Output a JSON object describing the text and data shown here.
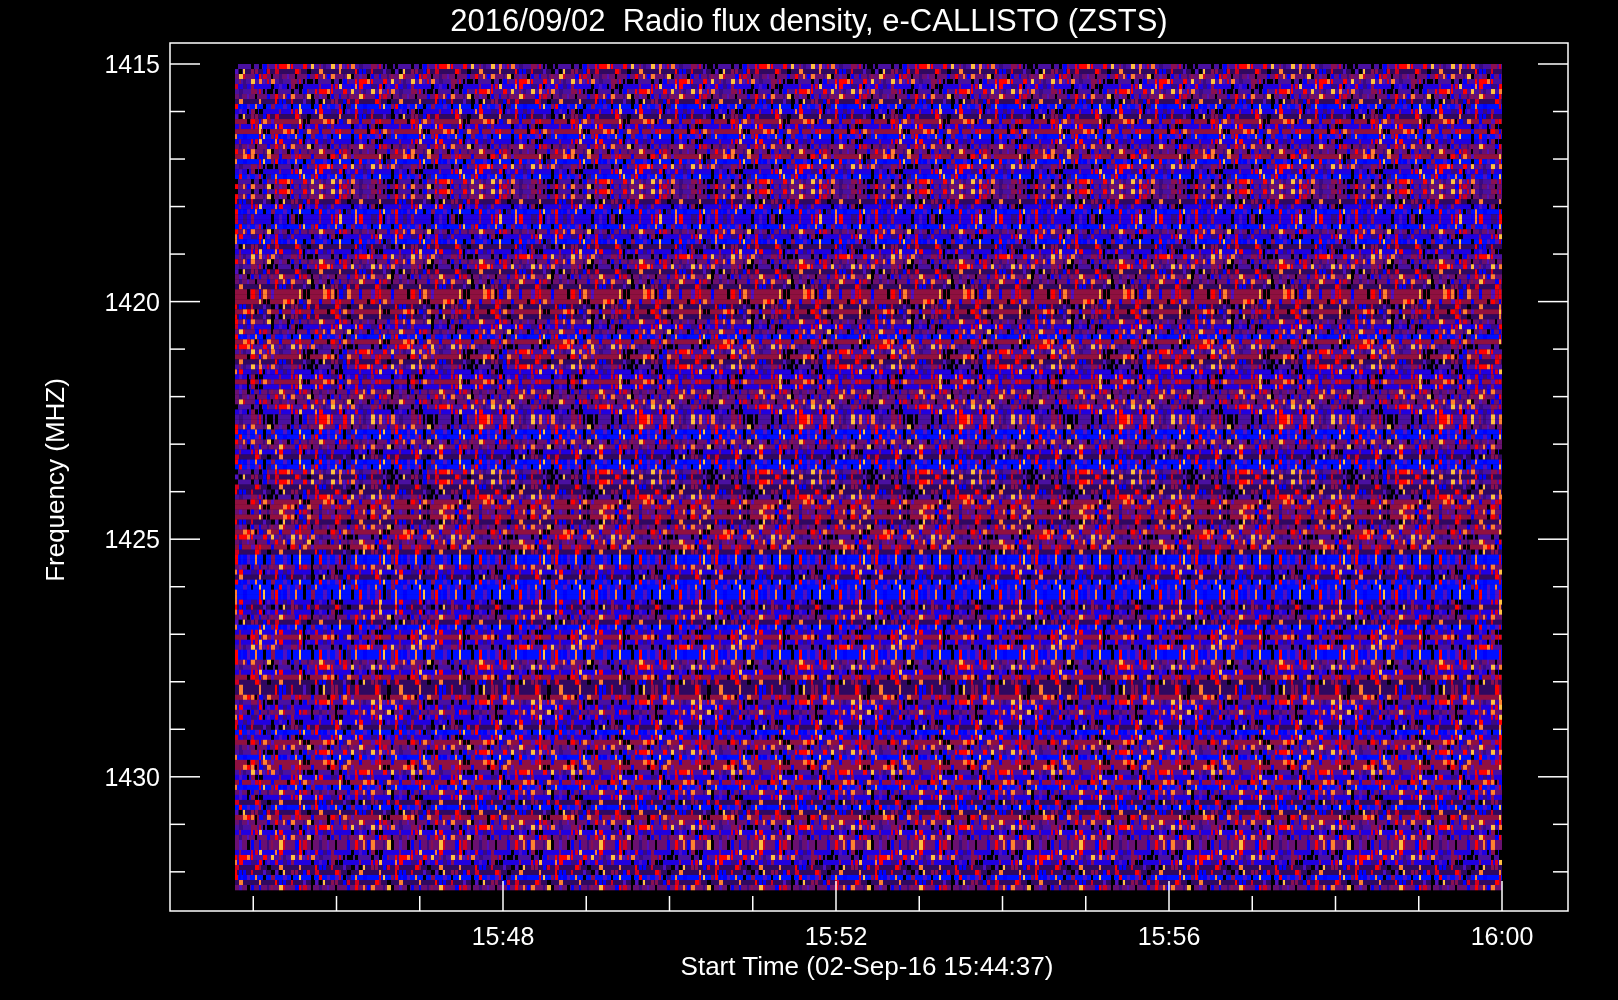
{
  "title": "2016/09/02  Radio flux density, e-CALLISTO (ZSTS)",
  "y_axis": {
    "label": "Frequency (MHZ)",
    "ticks": [
      "1415",
      "1420",
      "1425",
      "1430"
    ]
  },
  "x_axis": {
    "label": "Start Time (02-Sep-16 15:44:37)",
    "ticks": [
      "15:48",
      "15:52",
      "15:56",
      "16:00"
    ]
  }
}
